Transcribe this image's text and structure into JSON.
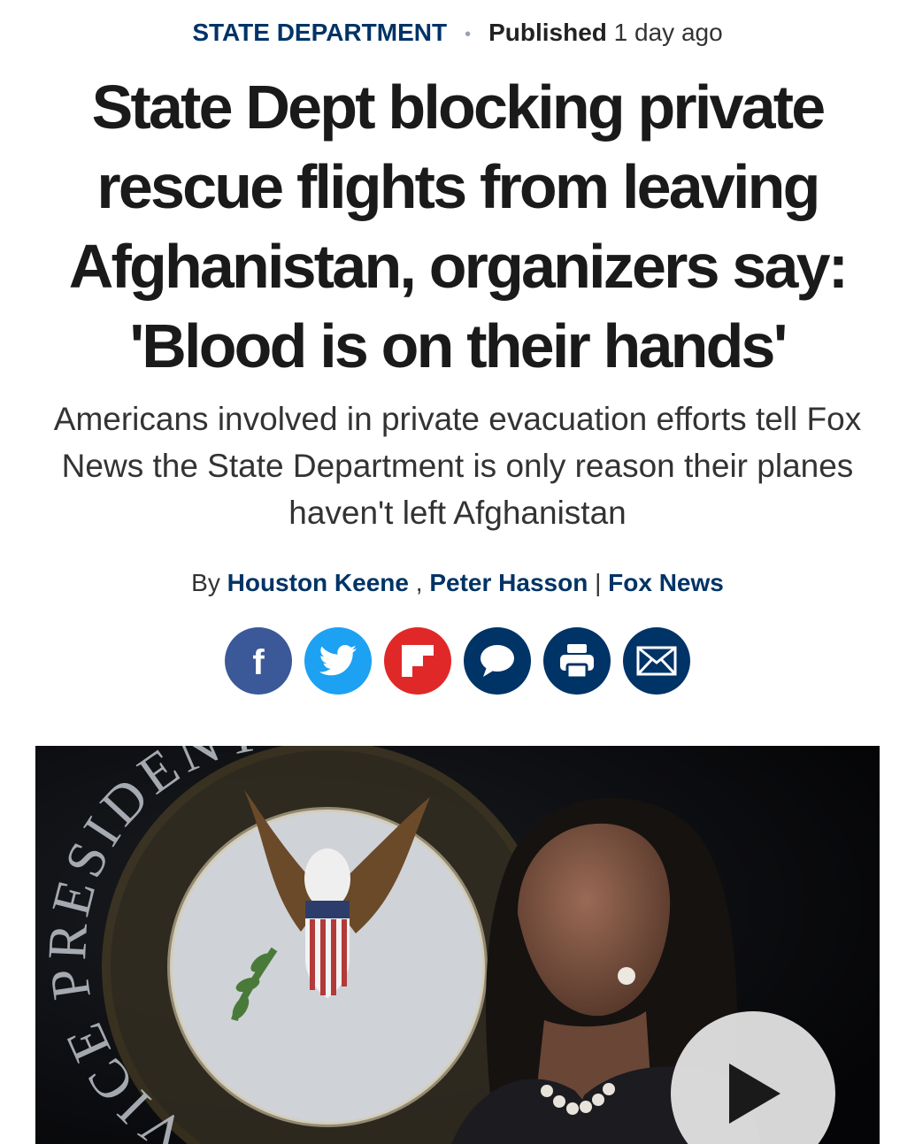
{
  "article": {
    "category": "STATE DEPARTMENT",
    "separator": "•",
    "published_label": "Published",
    "published_ago": "1 day ago",
    "headline": "State Dept blocking private rescue flights from leaving Afghanistan, organizers say: 'Blood is on their hands'",
    "dek": "Americans involved in private evacuation efforts tell Fox News the State Department is only reason their planes haven't left Afghanistan",
    "byline": {
      "by": "By",
      "authors": [
        "Houston Keene",
        "Peter Hasson"
      ],
      "comma": ",",
      "pipe": "|",
      "outlet": "Fox News"
    }
  },
  "share": [
    {
      "icon": "facebook-icon",
      "color": "#3b5998"
    },
    {
      "icon": "twitter-icon",
      "color": "#1da1f2"
    },
    {
      "icon": "flipboard-icon",
      "color": "#e12828"
    },
    {
      "icon": "comment-icon",
      "color": "#003366"
    },
    {
      "icon": "print-icon",
      "color": "#003366"
    },
    {
      "icon": "email-icon",
      "color": "#003366"
    }
  ],
  "media": {
    "seal_text": "VICE PRESIDENT",
    "play_icon": "play-icon"
  },
  "colors": {
    "brand_navy": "#003366"
  }
}
